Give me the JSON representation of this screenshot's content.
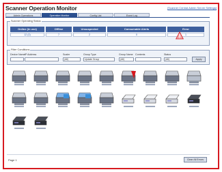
{
  "header": {
    "title": "Scanner Operation Monitor",
    "top_link": "[Scanner Central Admin Server Settings]"
  },
  "tabs": [
    {
      "label": "Admin Operations",
      "active": false
    },
    {
      "label": "Operation Monitor",
      "active": true
    },
    {
      "label": "Config List",
      "active": false
    },
    {
      "label": "Event Log",
      "active": false
    }
  ],
  "status": {
    "box_title": "Scanner Operating Status",
    "headers": [
      "Online (in use)",
      "Offline",
      "Unsuspected",
      "Consumable Alerts",
      "Error"
    ],
    "values": [
      "12 (0)",
      "7",
      "2",
      "0",
      "1"
    ]
  },
  "filter": {
    "box_title": "Filter Conditions",
    "labels": [
      "Device Name",
      "IP Address",
      "Scaler",
      "Group Type",
      "Group Name",
      "Contents",
      "Status"
    ],
    "scaler_value": "(All)",
    "group_type_value": "Update Group",
    "group_name_value": "(All)",
    "status_value": "(All)",
    "apply_label": "Apply"
  },
  "devices": [
    {
      "type": "scanner-icon",
      "state": "normal"
    },
    {
      "type": "scanner-icon",
      "state": "normal"
    },
    {
      "type": "scanner-icon",
      "state": "normal"
    },
    {
      "type": "scanner-icon",
      "state": "normal"
    },
    {
      "type": "scanner-icon",
      "state": "normal"
    },
    {
      "type": "scanner-icon",
      "state": "error"
    },
    {
      "type": "scanner-icon",
      "state": "normal"
    },
    {
      "type": "scanner-icon",
      "state": "normal"
    },
    {
      "type": "scanner-icon",
      "state": "offline"
    },
    {
      "type": "scanner-icon",
      "state": "normal"
    },
    {
      "type": "scanner-icon",
      "state": "normal"
    },
    {
      "type": "scanner-icon",
      "state": "highlight"
    },
    {
      "type": "scanner-icon",
      "state": "highlight"
    },
    {
      "type": "scanner-icon",
      "state": "normal"
    },
    {
      "type": "flatbed-scanner-icon",
      "state": "normal"
    },
    {
      "type": "flatbed-scanner-icon",
      "state": "normal"
    },
    {
      "type": "flatbed-scanner-icon",
      "state": "normal"
    },
    {
      "type": "flatbed-scanner-icon",
      "state": "dark"
    },
    {
      "type": "flatbed-scanner-icon",
      "state": "dark"
    },
    {
      "type": "flatbed-scanner-icon",
      "state": "dark"
    }
  ],
  "footer": {
    "page_text": "Page 1",
    "clear_label": "Clear All Errors"
  },
  "colors": {
    "accent": "#2b4f8f",
    "error": "#d7191f",
    "frame": "#d7191f"
  }
}
